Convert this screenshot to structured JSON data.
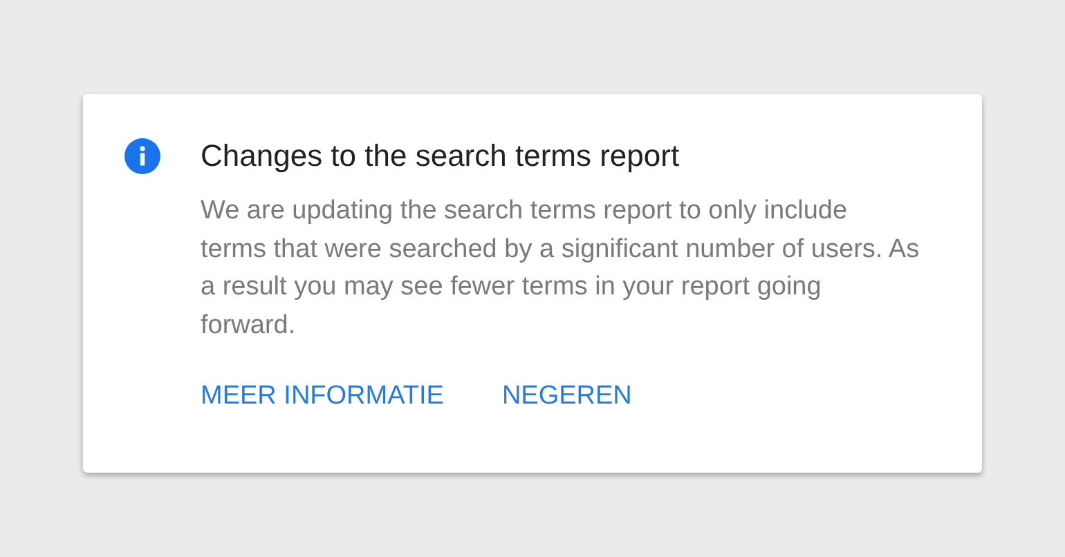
{
  "dialog": {
    "title": "Changes to the search terms report",
    "message": "We are updating the search terms report to only include terms that were searched by a significant number of users. As a result you may see fewer terms in your report going forward.",
    "buttons": [
      {
        "label": "MEER INFORMATIE"
      },
      {
        "label": "NEGEREN"
      }
    ]
  }
}
